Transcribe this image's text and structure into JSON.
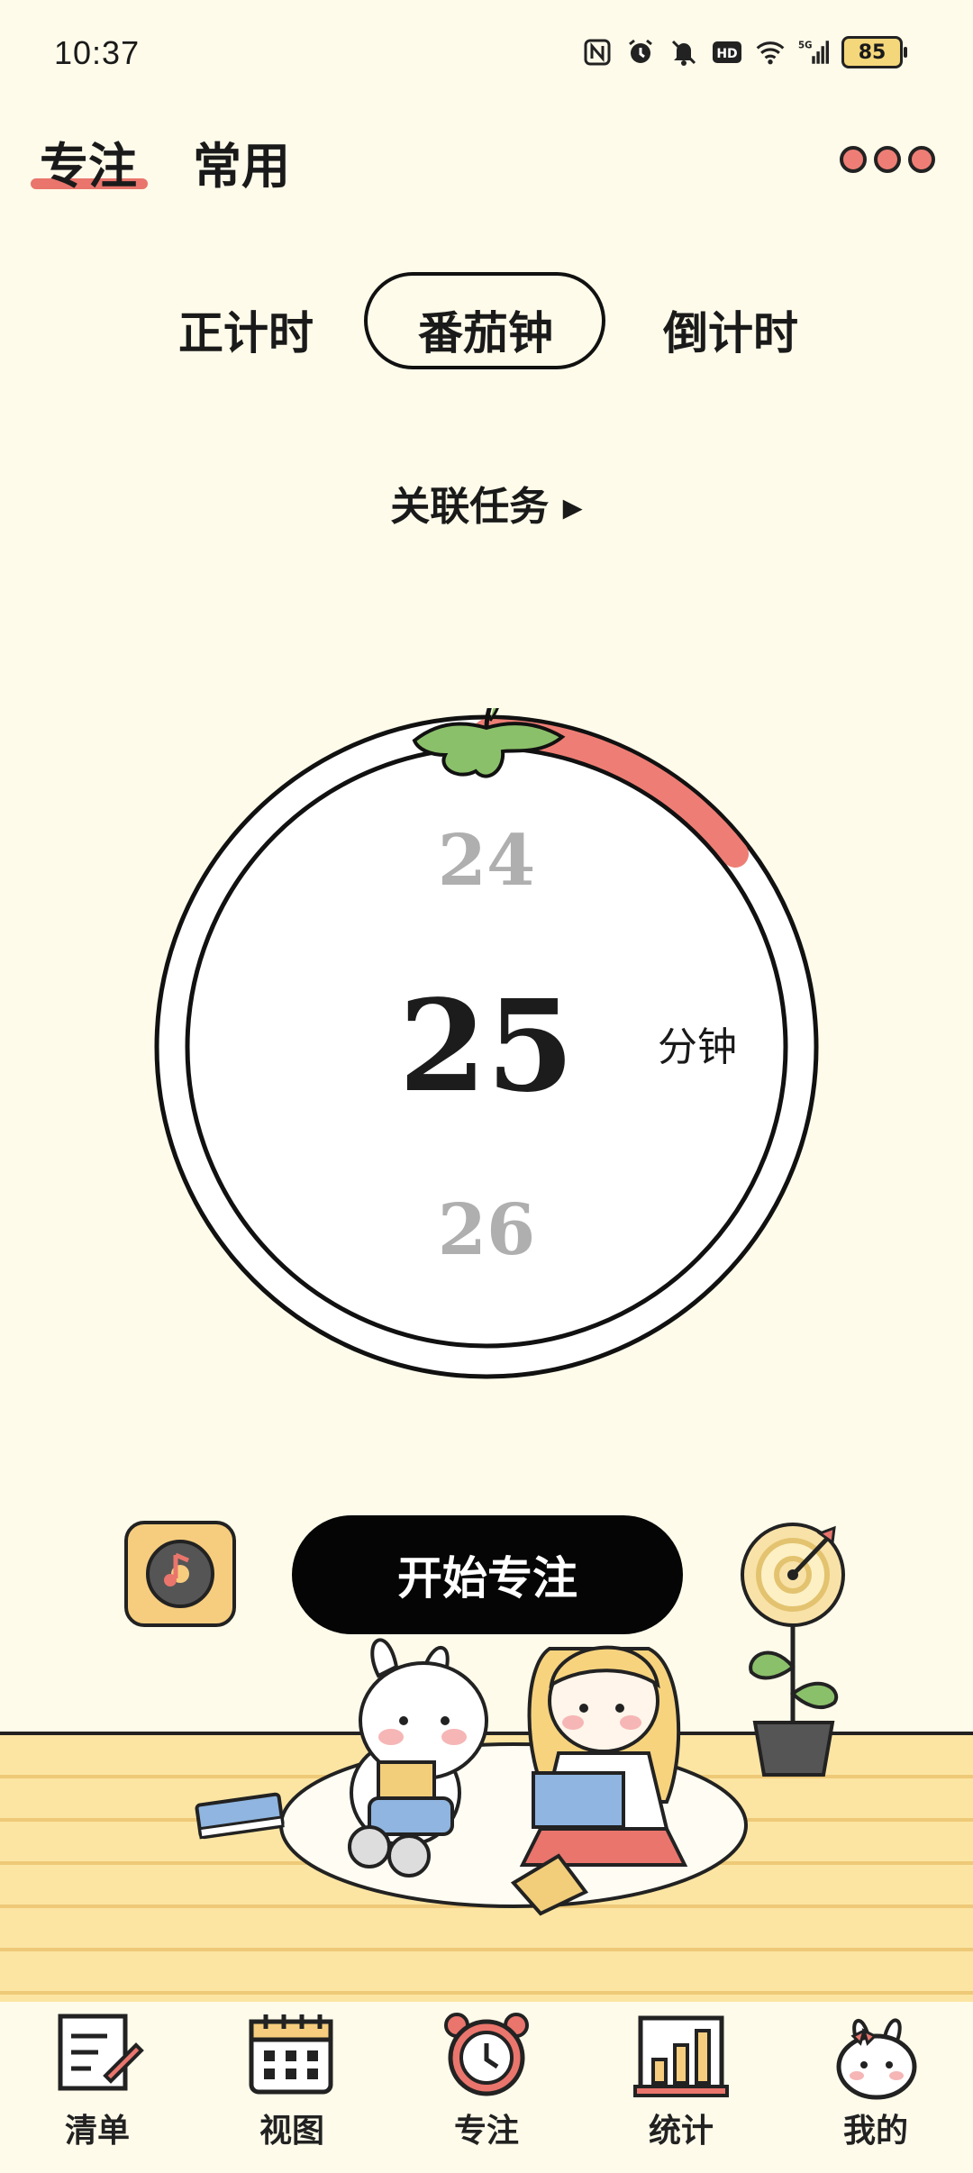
{
  "status": {
    "time": "10:37",
    "battery": "85",
    "icons": [
      "nfc-icon",
      "alarm-icon",
      "mute-icon",
      "hd-icon",
      "wifi-icon",
      "5g-signal-icon"
    ]
  },
  "header": {
    "tabs": [
      {
        "label": "专注",
        "active": true
      },
      {
        "label": "常用",
        "active": false
      }
    ]
  },
  "modes": {
    "items": [
      "正计时",
      "番茄钟",
      "倒计时"
    ],
    "selected": "番茄钟"
  },
  "linked_task": {
    "label": "关联任务 ▸"
  },
  "timer": {
    "prev": "24",
    "value": "25",
    "next": "26",
    "unit": "分钟"
  },
  "actions": {
    "start_label": "开始专注"
  },
  "nav": {
    "items": [
      {
        "label": "清单"
      },
      {
        "label": "视图"
      },
      {
        "label": "专注"
      },
      {
        "label": "统计"
      },
      {
        "label": "我的"
      }
    ]
  },
  "colors": {
    "background": "#FEFBEA",
    "accent": "#EE7E75",
    "ink": "#111111",
    "leaf": "#8BC06A"
  }
}
